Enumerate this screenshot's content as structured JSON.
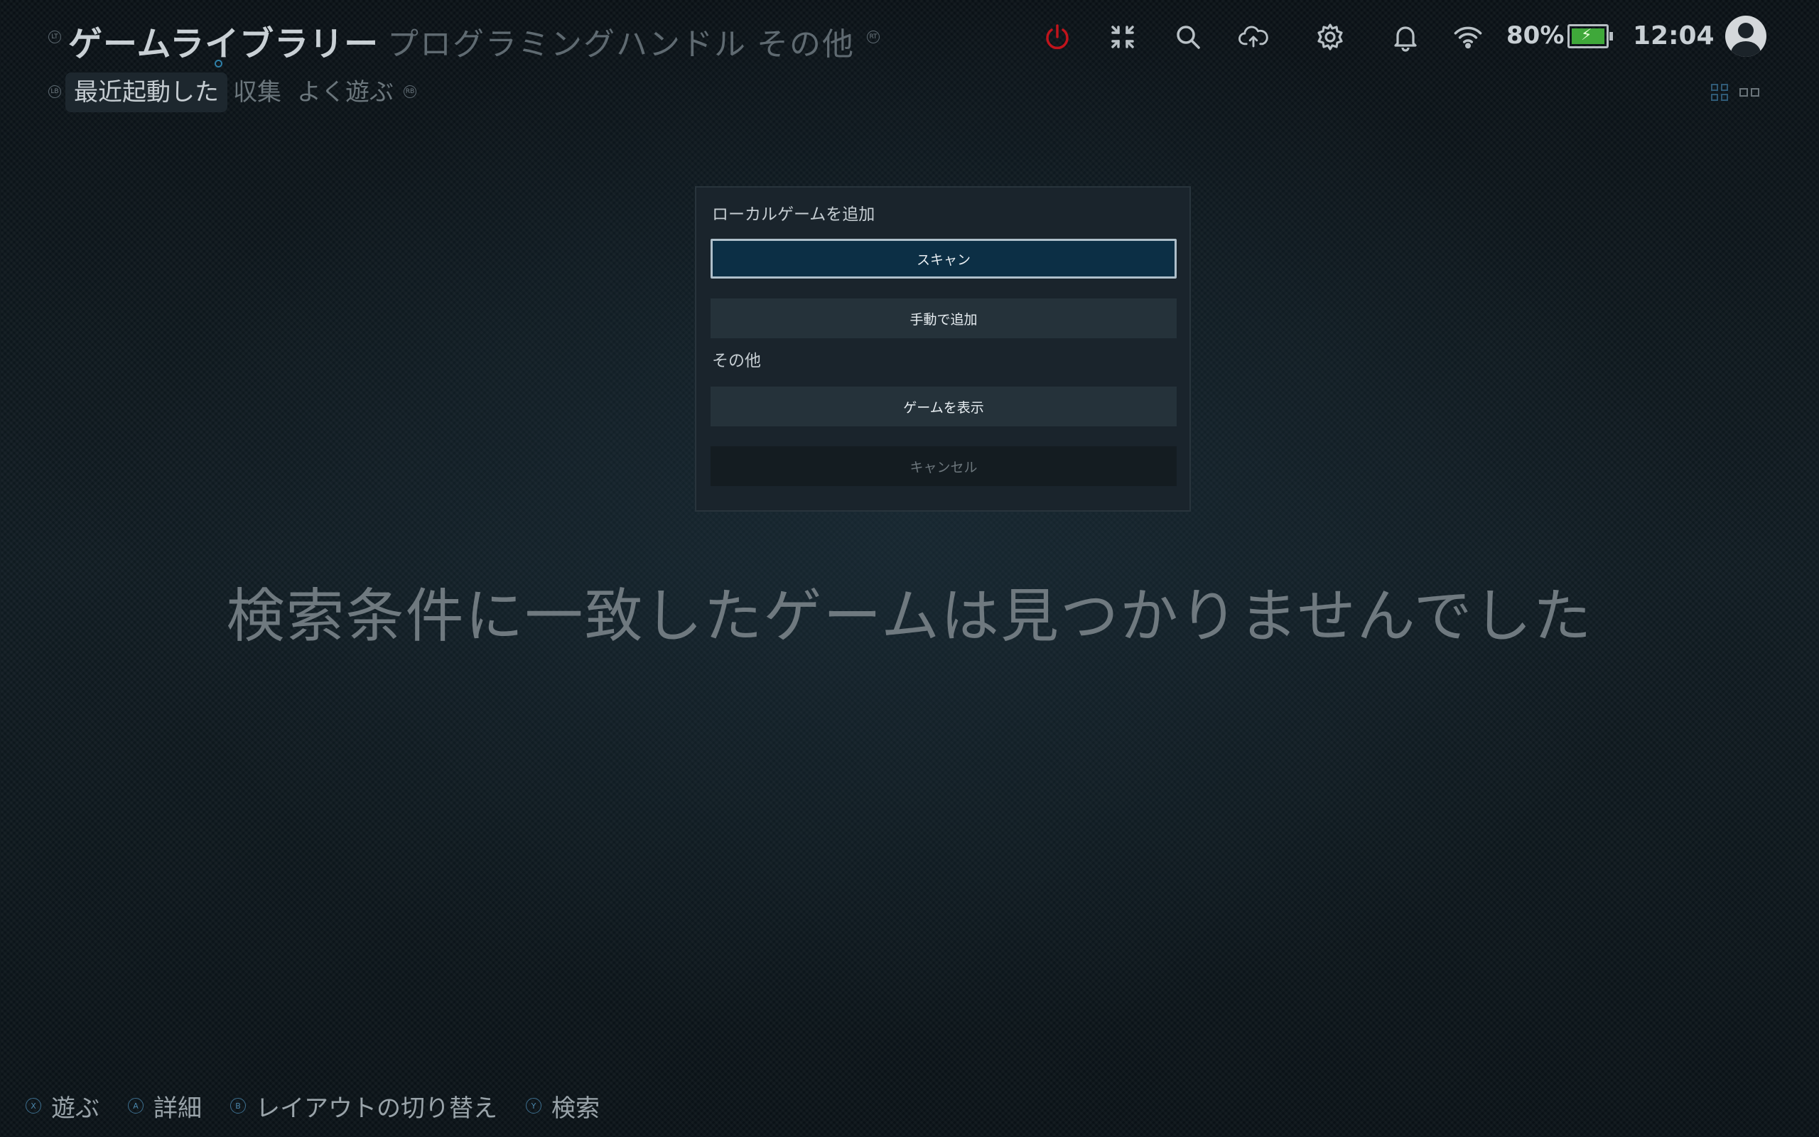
{
  "topbar": {
    "lt": "LT",
    "rt": "RT",
    "tabs": [
      {
        "label": "ゲームライブラリー"
      },
      {
        "label": "プログラミングハンドル"
      },
      {
        "label": "その他"
      }
    ],
    "icons": {
      "power": "power-icon",
      "shrink": "shrink-icon",
      "search": "search-icon",
      "cloud": "cloud-upload-icon",
      "settings": "gear-icon",
      "notifications": "bell-icon",
      "wifi": "wifi-icon"
    },
    "battery_percent": "80%",
    "clock": "12:04",
    "colors": {
      "power": "#c0141c",
      "battery": "#3fa83a",
      "accent": "#2f80a8"
    }
  },
  "subtabs": {
    "lb": "LB",
    "rb": "RB",
    "items": [
      {
        "label": "最近起動した"
      },
      {
        "label": "収集"
      },
      {
        "label": "よく遊ぶ"
      }
    ]
  },
  "dialog": {
    "section_add": "ローカルゲームを追加",
    "scan": "スキャン",
    "manual": "手動で追加",
    "section_other": "その他",
    "show_games": "ゲームを表示",
    "cancel": "キャンセル"
  },
  "empty_message": "検索条件に一致したゲームは見つかりませんでした",
  "footer": {
    "hints": [
      {
        "badge": "X",
        "label": "遊ぶ"
      },
      {
        "badge": "A",
        "label": "詳細"
      },
      {
        "badge": "B",
        "label": "レイアウトの切り替え"
      },
      {
        "badge": "Y",
        "label": "検索"
      }
    ]
  }
}
